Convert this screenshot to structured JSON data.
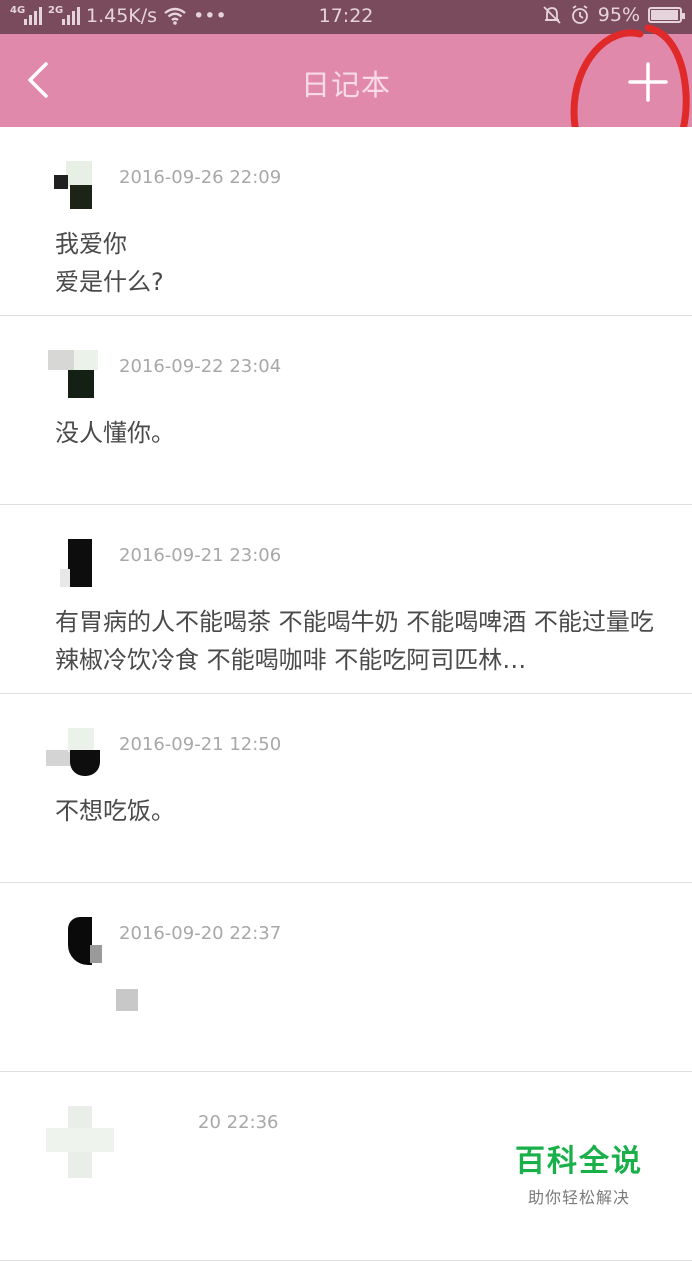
{
  "status_bar": {
    "net1": "4G",
    "net2": "2G",
    "speed": "1.45K/s",
    "dots": "•••",
    "time": "17:22",
    "battery": "95%",
    "battery_level": 0.95
  },
  "nav": {
    "title": "日记本",
    "add_symbol": "+",
    "back_icon": "chevron-left-icon",
    "annotation_color": "#e02a2a"
  },
  "entries": [
    {
      "date": "2016-09-26 22:09",
      "text": "我爱你\n爱是什么?"
    },
    {
      "date": "2016-09-22 23:04",
      "text": "没人懂你。"
    },
    {
      "date": "2016-09-21 23:06",
      "text": "有胃病的人不能喝茶 不能喝牛奶 不能喝啤酒 不能过量吃辣椒冷饮冷食 不能喝咖啡 不能吃阿司匹林…"
    },
    {
      "date": "2016-09-21 12:50",
      "text": "不想吃饭。"
    },
    {
      "date": "2016-09-20 22:37",
      "text": ""
    },
    {
      "date": "20 22:36",
      "text": ""
    }
  ],
  "watermark": {
    "big": "百科全说",
    "small": "助你轻松解决"
  },
  "colors": {
    "nav_bg": "#e189ab",
    "status_bg": "#7a4a5d",
    "watermark_green": "#19b04a"
  }
}
